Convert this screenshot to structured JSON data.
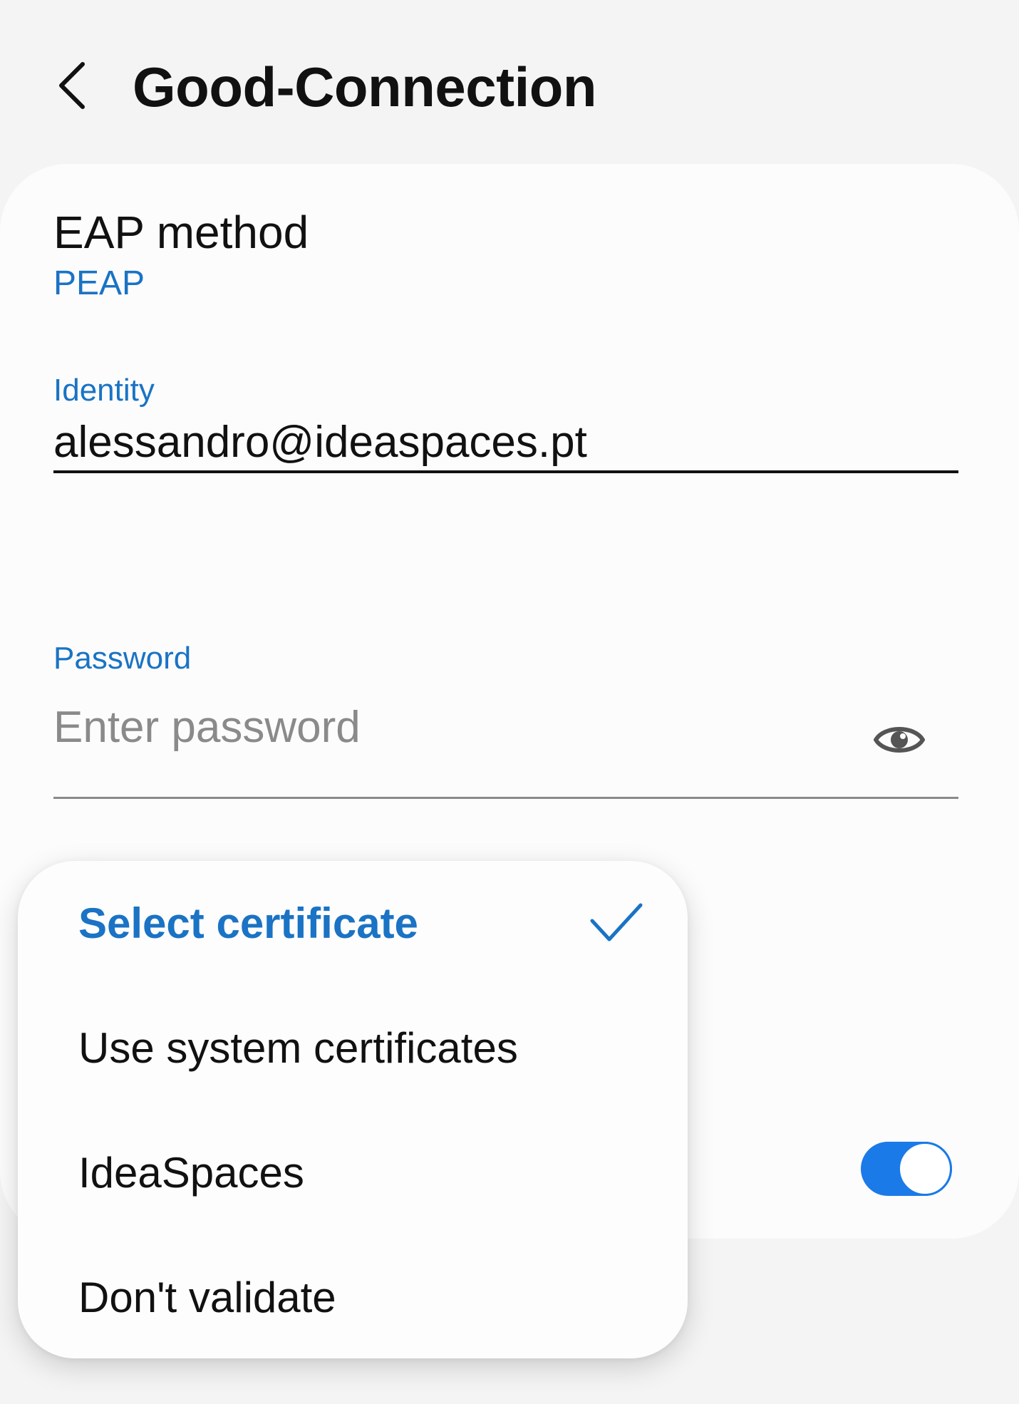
{
  "header": {
    "title": "Good-Connection",
    "back_icon": "chevron-left-icon"
  },
  "form": {
    "eap_method": {
      "label": "EAP method",
      "value": "PEAP"
    },
    "identity": {
      "label": "Identity",
      "value": "alessandro@ideaspaces.pt"
    },
    "password": {
      "label": "Password",
      "placeholder": "Enter password",
      "value": "",
      "toggle_icon": "eye-icon"
    },
    "toggle_on": true
  },
  "certificate_dropdown": {
    "options": [
      {
        "label": "Select certificate",
        "selected": true
      },
      {
        "label": "Use system certificates",
        "selected": false
      },
      {
        "label": "IdeaSpaces",
        "selected": false
      },
      {
        "label": "Don't validate",
        "selected": false
      }
    ],
    "check_icon": "check-icon"
  },
  "colors": {
    "accent": "#1a73c4",
    "toggle_accent": "#1a7ae8",
    "background": "#f4f4f4",
    "card": "#fcfcfc",
    "text": "#111111",
    "placeholder": "#8a8a8a"
  }
}
